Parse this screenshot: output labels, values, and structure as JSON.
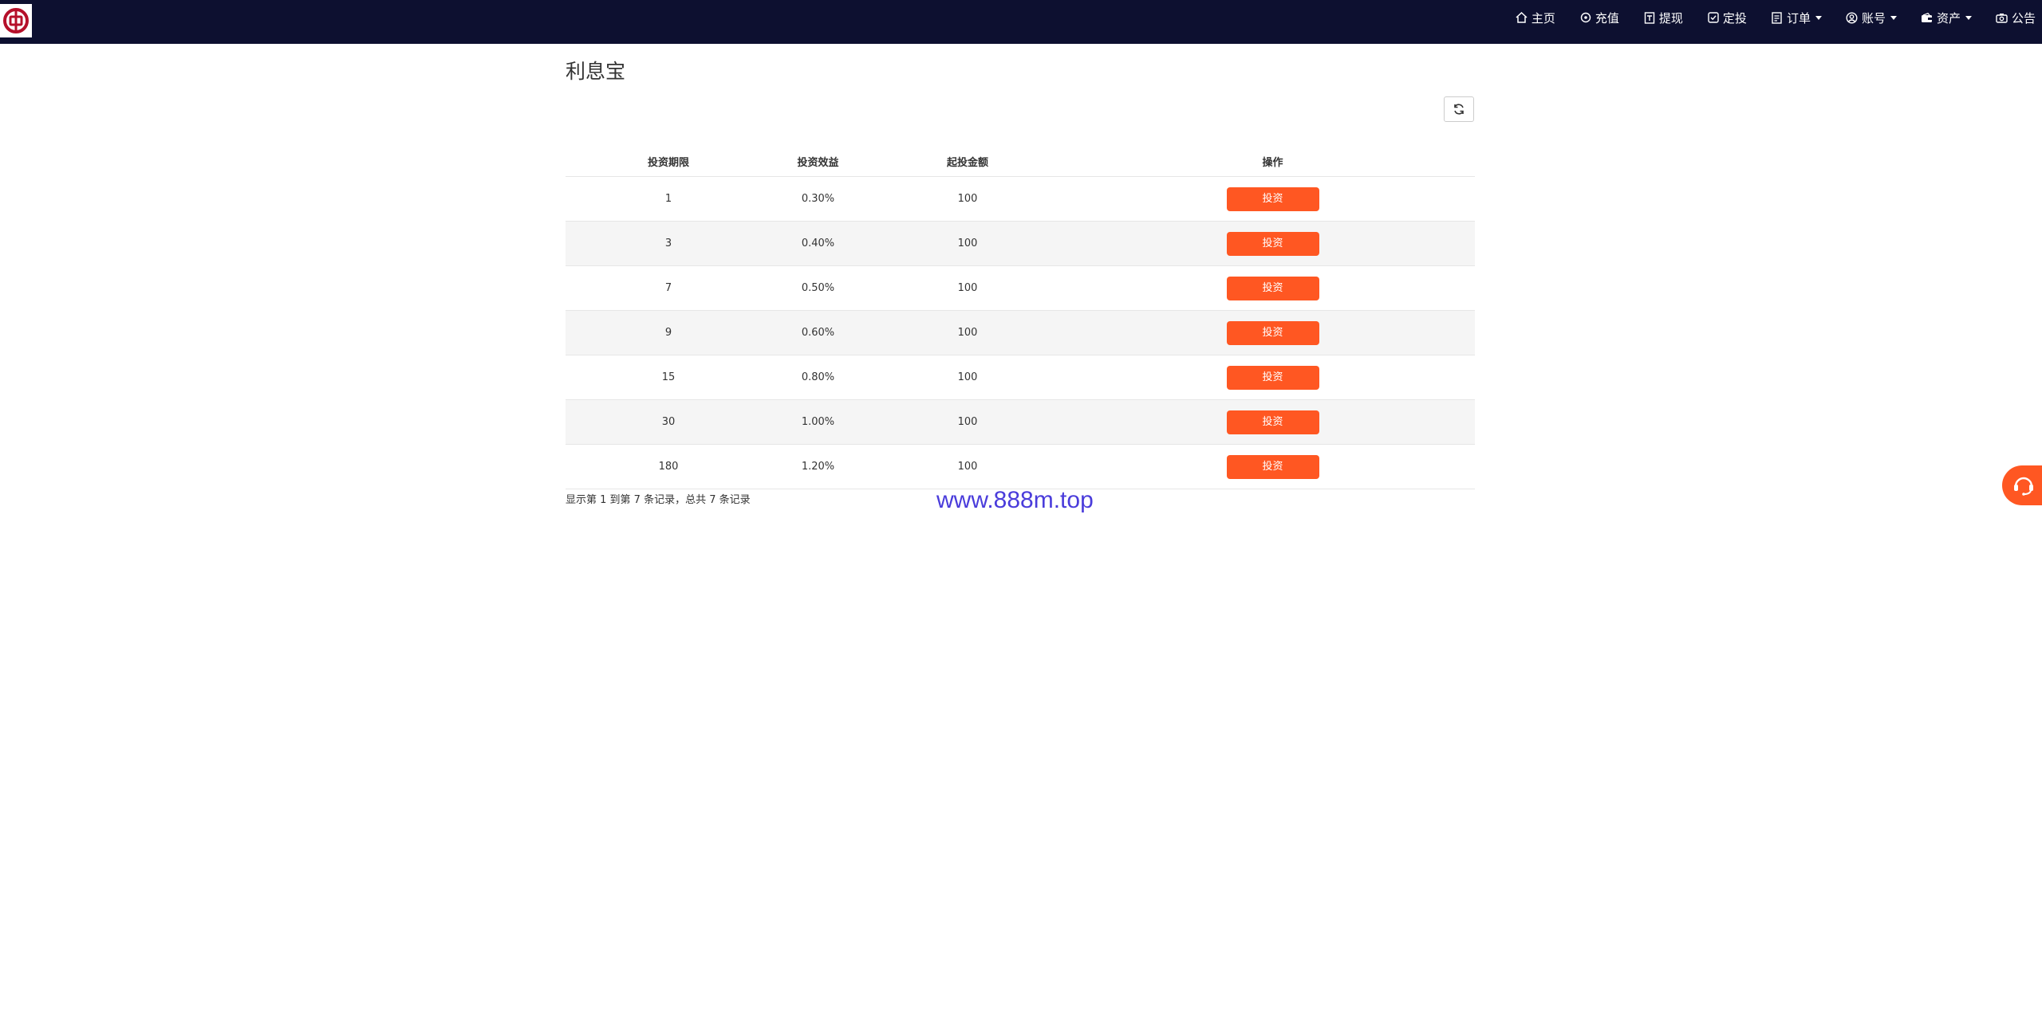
{
  "nav": {
    "items": [
      {
        "label": "主页",
        "icon": "home-icon"
      },
      {
        "label": "充值",
        "icon": "recharge-icon"
      },
      {
        "label": "提现",
        "icon": "withdraw-icon"
      },
      {
        "label": "定投",
        "icon": "check-square-icon"
      },
      {
        "label": "订单",
        "icon": "order-icon",
        "dropdown": true
      },
      {
        "label": "账号",
        "icon": "user-icon",
        "dropdown": true
      },
      {
        "label": "资产",
        "icon": "wallet-icon",
        "dropdown": true
      },
      {
        "label": "公告",
        "icon": "announcement-icon"
      }
    ]
  },
  "page": {
    "title": "利息宝"
  },
  "table": {
    "headers": [
      "投资期限",
      "投资效益",
      "起投金额",
      "操作"
    ],
    "rows": [
      {
        "period": "1",
        "rate": "0.30%",
        "min": "100",
        "action": "投资"
      },
      {
        "period": "3",
        "rate": "0.40%",
        "min": "100",
        "action": "投资"
      },
      {
        "period": "7",
        "rate": "0.50%",
        "min": "100",
        "action": "投资"
      },
      {
        "period": "9",
        "rate": "0.60%",
        "min": "100",
        "action": "投资"
      },
      {
        "period": "15",
        "rate": "0.80%",
        "min": "100",
        "action": "投资"
      },
      {
        "period": "30",
        "rate": "1.00%",
        "min": "100",
        "action": "投资"
      },
      {
        "period": "180",
        "rate": "1.20%",
        "min": "100",
        "action": "投资"
      }
    ]
  },
  "pagination": {
    "info": "显示第 1 到第 7 条记录，总共 7 条记录"
  },
  "watermark": "www.888m.top",
  "colors": {
    "navbar": "#0d1030",
    "accent": "#ff5722",
    "watermark": "#4a3cdb"
  }
}
